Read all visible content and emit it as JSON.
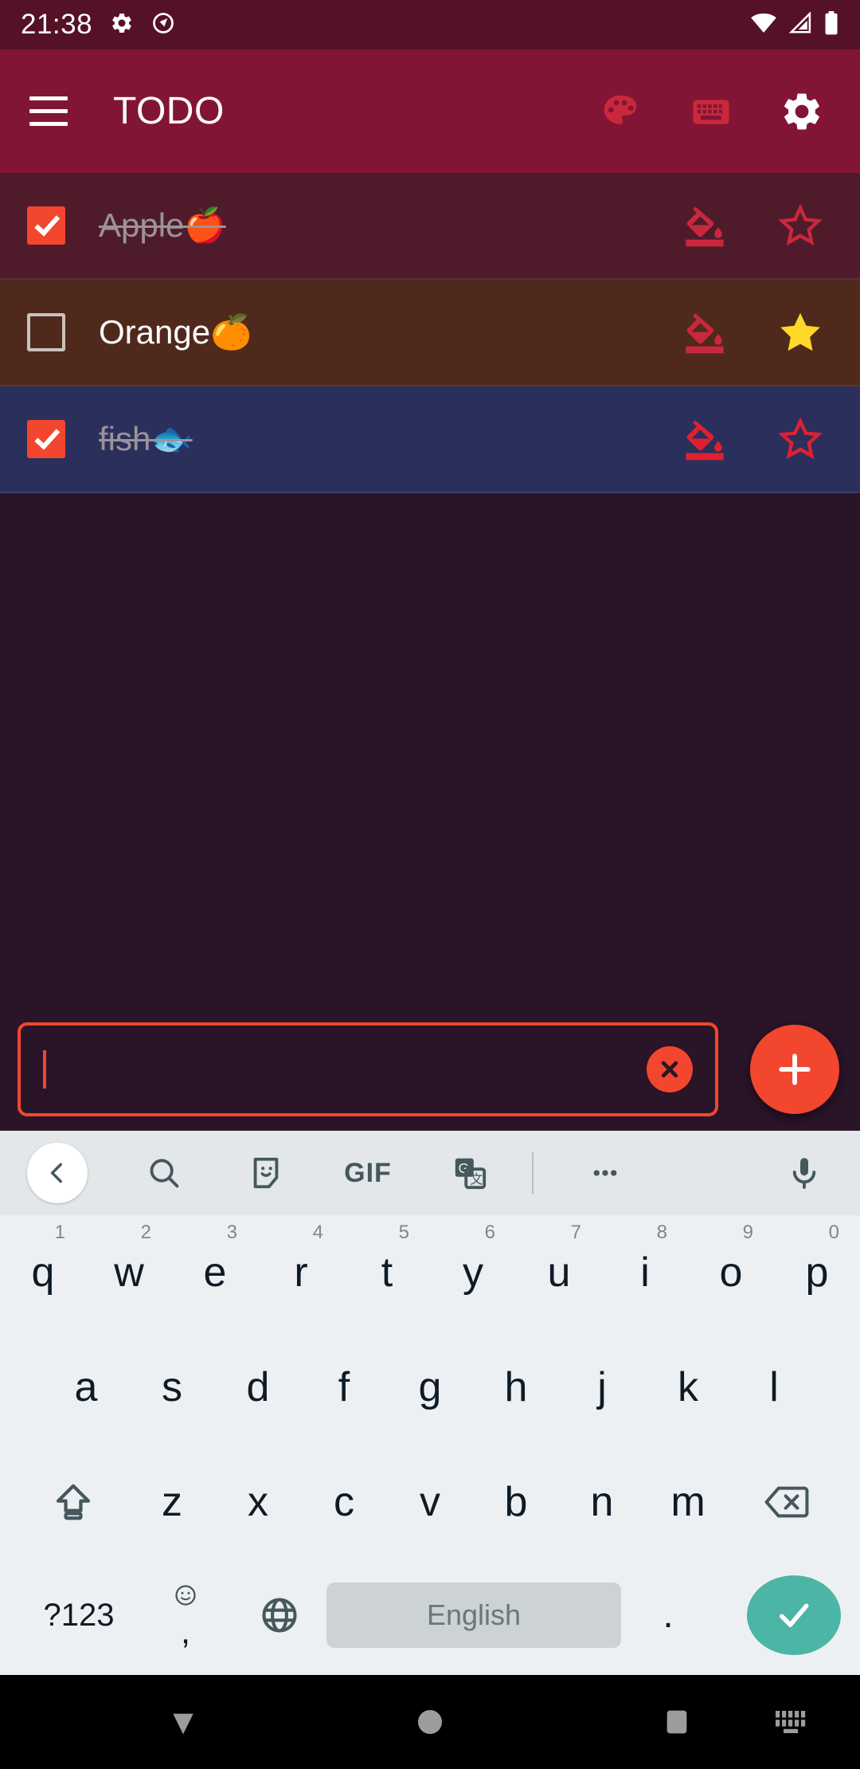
{
  "status_bar": {
    "clock": "21:38",
    "left_icons": [
      "gear-icon",
      "quick-settings-icon"
    ],
    "right_icons": [
      "wifi-icon",
      "cellular-signal-icon",
      "battery-icon"
    ],
    "background": "#551125"
  },
  "app_bar": {
    "title": "TODO",
    "menu_icon": "hamburger-menu-icon",
    "background": "#821535",
    "actions": [
      {
        "name": "palette-icon",
        "label": "Change theme color",
        "color": "#C9283C"
      },
      {
        "name": "keyboard-icon",
        "label": "Toggle keyboard",
        "color": "#C9283C"
      },
      {
        "name": "gear-icon",
        "label": "Settings",
        "color": "#FFFFFF"
      }
    ]
  },
  "todo_list": {
    "items": [
      {
        "label": "Apple🍎",
        "checked": true,
        "starred": false,
        "row_background": "#4F1B2B",
        "fill_icon": "format-color-fill-icon",
        "star_icon": "star-outline-icon"
      },
      {
        "label": "Orange🍊",
        "checked": false,
        "starred": true,
        "row_background": "#50291D",
        "fill_icon": "format-color-fill-icon",
        "star_icon": "star-filled-icon"
      },
      {
        "label": "fish🐟",
        "checked": true,
        "starred": false,
        "row_background": "#2B2F5C",
        "fill_icon": "format-color-fill-icon",
        "star_icon": "star-outline-icon"
      }
    ],
    "checked_color": "#F2462F",
    "starred_color": "#FFD829"
  },
  "input": {
    "value": "",
    "placeholder": "",
    "border_color": "#F2462F",
    "clear_icon": "close-x-icon",
    "add_icon": "plus-icon",
    "add_button_label": "Add task"
  },
  "keyboard": {
    "toolbar": [
      {
        "name": "back-chevron-icon",
        "label": "Back"
      },
      {
        "name": "search-icon",
        "label": "Search"
      },
      {
        "name": "sticker-icon",
        "label": "Stickers"
      },
      {
        "name": "gif-icon",
        "label": "GIF"
      },
      {
        "name": "translate-icon",
        "label": "Translate"
      },
      {
        "name": "more-options-icon",
        "label": "More"
      },
      {
        "name": "microphone-icon",
        "label": "Voice input"
      }
    ],
    "gif_label": "GIF",
    "row1": [
      {
        "key": "q",
        "num": "1"
      },
      {
        "key": "w",
        "num": "2"
      },
      {
        "key": "e",
        "num": "3"
      },
      {
        "key": "r",
        "num": "4"
      },
      {
        "key": "t",
        "num": "5"
      },
      {
        "key": "y",
        "num": "6"
      },
      {
        "key": "u",
        "num": "7"
      },
      {
        "key": "i",
        "num": "8"
      },
      {
        "key": "o",
        "num": "9"
      },
      {
        "key": "p",
        "num": "0"
      }
    ],
    "row2": [
      "a",
      "s",
      "d",
      "f",
      "g",
      "h",
      "j",
      "k",
      "l"
    ],
    "row3": [
      "z",
      "x",
      "c",
      "v",
      "b",
      "n",
      "m"
    ],
    "shift_icon": "shift-key-icon",
    "backspace_icon": "backspace-key-icon",
    "symbols_key": "?123",
    "emoji_comma_key": ",",
    "globe_icon": "language-globe-icon",
    "space_label": "English",
    "period_key": ".",
    "enter_icon": "enter-check-icon",
    "enter_color": "#4CB5A5",
    "background": "#EDF0F2"
  },
  "nav_bar": {
    "background": "#000000",
    "buttons": [
      {
        "name": "nav-back-icon",
        "label": "Back / hide keyboard"
      },
      {
        "name": "nav-home-icon",
        "label": "Home"
      },
      {
        "name": "nav-recents-icon",
        "label": "Recent apps"
      },
      {
        "name": "nav-keyboard-switch-icon",
        "label": "Switch keyboard"
      }
    ]
  }
}
